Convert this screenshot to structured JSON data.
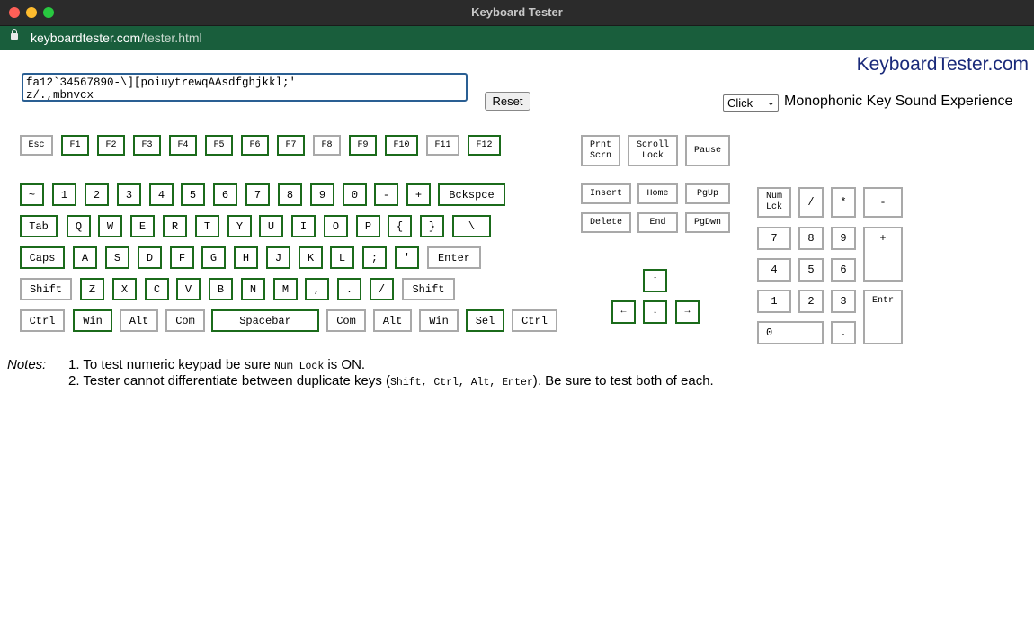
{
  "window": {
    "title": "Keyboard Tester"
  },
  "address": {
    "domain": "keyboardtester.com",
    "path": "/tester.html"
  },
  "brand": "KeyboardTester.com",
  "typed_text": "fa12`34567890-\\][poiuytrewqAAsdfghjkkl;'\nz/.,mbnvcx",
  "reset_label": "Reset",
  "sound": {
    "selected": "Click",
    "label": "Monophonic Key Sound Experience"
  },
  "keys": {
    "esc": "Esc",
    "f1": "F1",
    "f2": "F2",
    "f3": "F3",
    "f4": "F4",
    "f5": "F5",
    "f6": "F6",
    "f7": "F7",
    "f8": "F8",
    "f9": "F9",
    "f10": "F10",
    "f11": "F11",
    "f12": "F12",
    "tilde": "~",
    "d1": "1",
    "d2": "2",
    "d3": "3",
    "d4": "4",
    "d5": "5",
    "d6": "6",
    "d7": "7",
    "d8": "8",
    "d9": "9",
    "d0": "0",
    "minus": "-",
    "plus": "+",
    "backspace": "Bckspce",
    "tab": "Tab",
    "q": "Q",
    "w": "W",
    "e": "E",
    "r": "R",
    "t": "T",
    "y": "Y",
    "u": "U",
    "i": "I",
    "o": "O",
    "p": "P",
    "lbrace": "{",
    "rbrace": "}",
    "backslash": "\\",
    "caps": "Caps",
    "a": "A",
    "s": "S",
    "d": "D",
    "f": "F",
    "g": "G",
    "h": "H",
    "j": "J",
    "k": "K",
    "l": "L",
    "semicolon": ";",
    "quote": "'",
    "enter": "Enter",
    "lshift": "Shift",
    "z": "Z",
    "x": "X",
    "c": "C",
    "v": "V",
    "b": "B",
    "n": "N",
    "m": "M",
    "comma": ",",
    "period": ".",
    "slash": "/",
    "rshift": "Shift",
    "lctrl": "Ctrl",
    "lwin": "Win",
    "lalt": "Alt",
    "lcom": "Com",
    "space": "Spacebar",
    "rcom": "Com",
    "ralt": "Alt",
    "rwin": "Win",
    "sel": "Sel",
    "rctrl": "Ctrl",
    "prtscn": "Prnt\nScrn",
    "scrolllock": "Scroll\nLock",
    "pause": "Pause",
    "insert": "Insert",
    "home": "Home",
    "pgup": "PgUp",
    "delete": "Delete",
    "end": "End",
    "pgdn": "PgDwn",
    "up": "↑",
    "left": "←",
    "down": "↓",
    "right": "→",
    "numlock": "Num\nLck",
    "np_div": "/",
    "np_mul": "*",
    "np_sub": "-",
    "np7": "7",
    "np8": "8",
    "np9": "9",
    "np_add": "+",
    "np4": "4",
    "np5": "5",
    "np6": "6",
    "np1": "1",
    "np2": "2",
    "np3": "3",
    "np_enter": "Entr",
    "np0": "0",
    "np_dot": "."
  },
  "notes": {
    "label": "Notes:",
    "n1_pre": "1. To test numeric keypad be sure ",
    "n1_code": "Num Lock",
    "n1_post": " is ON.",
    "n2_pre": "2. Tester cannot differentiate between duplicate keys (",
    "n2_code": "Shift, Ctrl, Alt, Enter",
    "n2_post": "). Be sure to test both of each."
  }
}
